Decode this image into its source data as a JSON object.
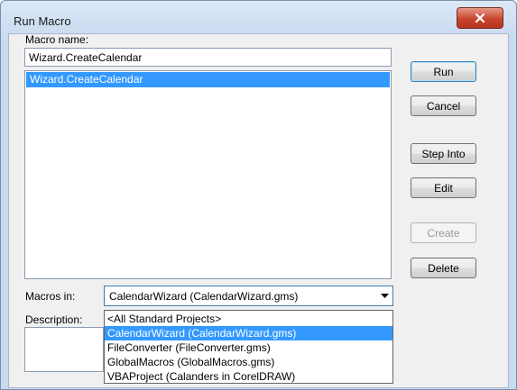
{
  "window": {
    "title": "Run Macro"
  },
  "macro_name": {
    "label": "Macro name:",
    "value": "Wizard.CreateCalendar"
  },
  "macro_list": {
    "items": [
      {
        "label": "Wizard.CreateCalendar",
        "selected": true
      }
    ]
  },
  "buttons": {
    "run": "Run",
    "cancel": "Cancel",
    "step_into": "Step Into",
    "edit": "Edit",
    "create": "Create",
    "delete": "Delete"
  },
  "macros_in": {
    "label": "Macros in:",
    "selected": "CalendarWizard (CalendarWizard.gms)",
    "options": [
      "<All Standard Projects>",
      "CalendarWizard (CalendarWizard.gms)",
      "FileConverter (FileConverter.gms)",
      "GlobalMacros (GlobalMacros.gms)",
      "VBAProject (Calanders in CorelDRAW)"
    ],
    "highlighted_index": 1
  },
  "description": {
    "label": "Description:"
  },
  "colors": {
    "selection": "#3399ff",
    "close_button": "#c9432d"
  }
}
